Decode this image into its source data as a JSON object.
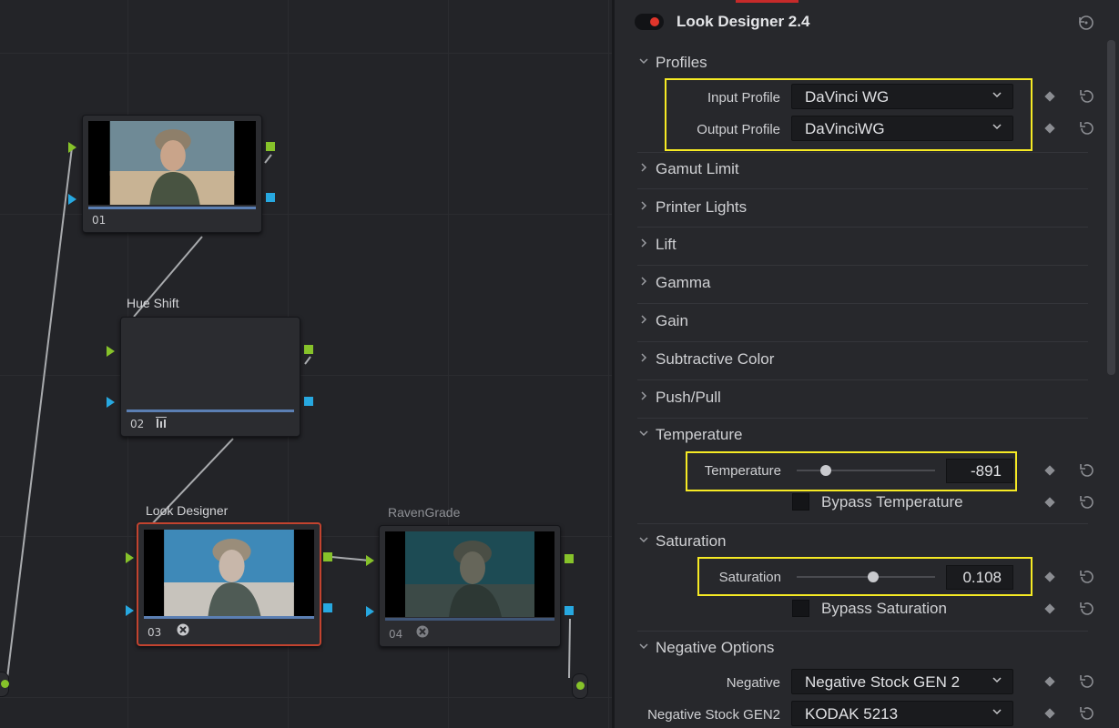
{
  "graph": {
    "nodes": [
      {
        "label": "",
        "number": "01"
      },
      {
        "label": "Hue Shift",
        "number": "02"
      },
      {
        "label": "Look Designer",
        "number": "03"
      },
      {
        "label": "RavenGrade",
        "number": "04"
      }
    ]
  },
  "inspector": {
    "plugin_title": "Look Designer 2.4",
    "enabled": true,
    "sections": {
      "profiles": {
        "title": "Profiles",
        "expanded": true
      },
      "gamut_limit": {
        "title": "Gamut Limit",
        "expanded": false
      },
      "printer_lights": {
        "title": "Printer Lights",
        "expanded": false
      },
      "lift": {
        "title": "Lift",
        "expanded": false
      },
      "gamma": {
        "title": "Gamma",
        "expanded": false
      },
      "gain": {
        "title": "Gain",
        "expanded": false
      },
      "subtractive_color": {
        "title": "Subtractive Color",
        "expanded": false
      },
      "push_pull": {
        "title": "Push/Pull",
        "expanded": false
      },
      "temperature": {
        "title": "Temperature",
        "expanded": true
      },
      "saturation": {
        "title": "Saturation",
        "expanded": true
      },
      "negative_options": {
        "title": "Negative Options",
        "expanded": true
      }
    },
    "input_profile": {
      "label": "Input Profile",
      "value": "DaVinci WG"
    },
    "output_profile": {
      "label": "Output Profile",
      "value": "DaVinciWG"
    },
    "temperature": {
      "label": "Temperature",
      "value": "-891",
      "slider_fraction": 0.21
    },
    "bypass_temperature": {
      "label": "Bypass Temperature",
      "checked": false
    },
    "saturation": {
      "label": "Saturation",
      "value": "0.108",
      "slider_fraction": 0.55
    },
    "bypass_saturation": {
      "label": "Bypass Saturation",
      "checked": false
    },
    "negative": {
      "label": "Negative",
      "value": "Negative Stock GEN 2"
    },
    "negative_stock": {
      "label": "Negative Stock GEN2",
      "value": "KODAK 5213"
    }
  },
  "colors": {
    "accent_red": "#e0352b",
    "highlight_yellow": "#f6ea24",
    "port_green": "#86c22a",
    "port_blue": "#27a8e0",
    "selected_node_border": "#c2432f"
  },
  "icons": [
    "reset-icon",
    "keyframe-diamond-icon",
    "chevron-down-icon",
    "chevron-right-icon",
    "dropdown-arrow-icon",
    "plugin-icon",
    "tracker-icon"
  ]
}
